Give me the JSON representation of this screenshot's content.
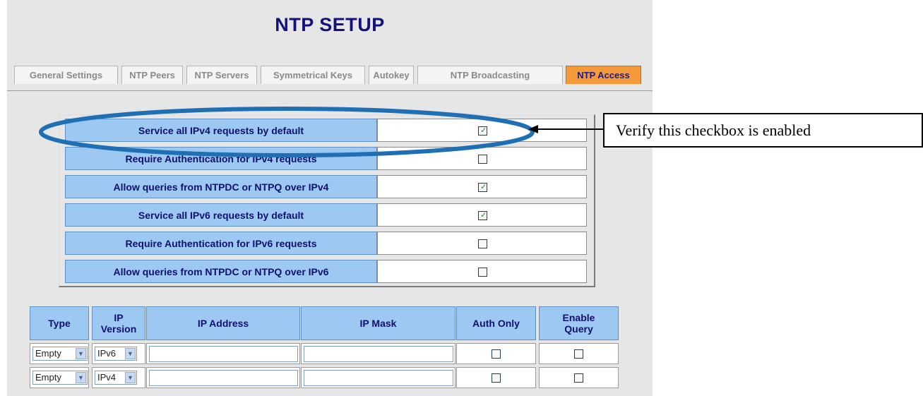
{
  "page_title": "NTP SETUP",
  "tabs": [
    {
      "label": "General Settings",
      "active": false
    },
    {
      "label": "NTP Peers",
      "active": false
    },
    {
      "label": "NTP Servers",
      "active": false
    },
    {
      "label": "Symmetrical Keys",
      "active": false
    },
    {
      "label": "Autokey",
      "active": false
    },
    {
      "label": "NTP Broadcasting",
      "active": false
    },
    {
      "label": "NTP Access",
      "active": true
    }
  ],
  "settings": [
    {
      "label": "Service all IPv4 requests by default",
      "checked": true
    },
    {
      "label": "Require Authentication for IPv4 requests",
      "checked": false
    },
    {
      "label": "Allow queries from NTPDC or NTPQ over IPv4",
      "checked": true
    },
    {
      "label": "Service all IPv6 requests by default",
      "checked": true
    },
    {
      "label": "Require Authentication for IPv6 requests",
      "checked": false
    },
    {
      "label": "Allow queries from NTPDC or NTPQ over IPv6",
      "checked": false
    }
  ],
  "access_table": {
    "headers": {
      "type": "Type",
      "ip_version_1": "IP",
      "ip_version_2": "Version",
      "ip_address": "IP Address",
      "ip_mask": "IP Mask",
      "auth_only": "Auth Only",
      "enable_query_1": "Enable",
      "enable_query_2": "Query"
    },
    "rows": [
      {
        "type": "Empty",
        "ip_version": "IPv6",
        "ip_address": "",
        "ip_mask": "",
        "auth_only": false,
        "enable_query": false
      },
      {
        "type": "Empty",
        "ip_version": "IPv4",
        "ip_address": "",
        "ip_mask": "",
        "auth_only": false,
        "enable_query": false
      }
    ]
  },
  "annotation": {
    "text": "Verify this checkbox is enabled"
  },
  "colors": {
    "header_blue": "#9dc8f2",
    "active_tab": "#f49a3a",
    "ellipse": "#1f6fb5",
    "check_green": "#1f8a1f"
  }
}
